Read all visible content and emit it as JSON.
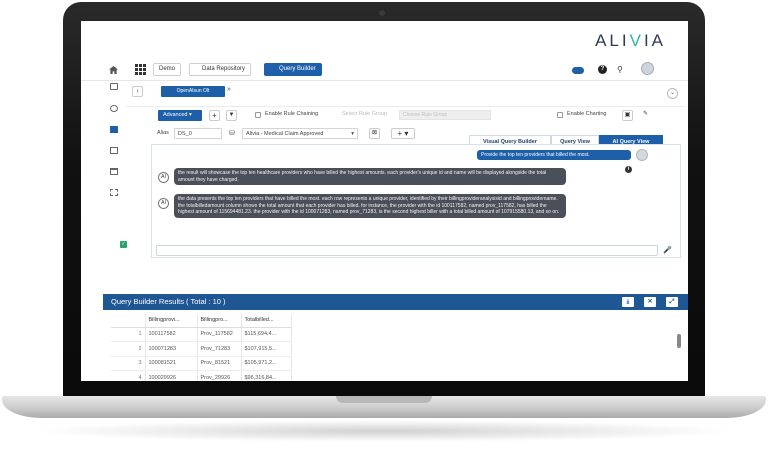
{
  "brand": {
    "logo_text_a": "ALI",
    "logo_text_v": "V",
    "logo_text_b": "IA"
  },
  "topbar": {
    "chips": [
      "Demo",
      "Data Repository",
      "Query Builder"
    ],
    "active_chip": "Query Builder"
  },
  "main": {
    "source_tab": "OpenAIsun Olt",
    "advanced_label": "Advanced",
    "enable_rule_chaining": "Enable Rule Chaining",
    "select_rule_group": "Select Rule Group",
    "choose_rule_group": "Choose Rule Group",
    "enable_charting": "Enable Charting",
    "alias_label": "Alias",
    "alias_value": "DS_0",
    "dataset_value": "Alivia - Medical Claim Approved",
    "view_tabs": [
      "Visual Query Builder",
      "Query View",
      "AI Query View"
    ],
    "active_view_tab": "AI Query View"
  },
  "chat": {
    "user_message": "Provide the top ten providers that billed the most.",
    "bot_label": "AI",
    "bot_message_1": "the result will showcase the top ten healthcare providers who have billed the highest amounts. each provider's unique id and name will be displayed alongside the total amount they have charged.",
    "bot_message_2": "the data presents the top ten providers that have billed the most. each row represents a unique provider, identified by their billingprovideranalysisid and billingprovidername. the totalbilledamount column shows the total amount that each provider has billed. for instance, the provider with the id 100117582, named prov_117582, has billed the highest amount of 115694481.23. the provider with the id 100071283, named prov_71283, is the second highest biller with a total billed amount of 107915580.13, and so on."
  },
  "results": {
    "title": "Query Builder Results ( Total : 10 )",
    "columns": [
      "Billingprovi...",
      "Billingpro...",
      "Totalbilled..."
    ],
    "rows": [
      {
        "n": "1",
        "id": "100117582",
        "name": "Prov_117582",
        "amt": "$115,694,4..."
      },
      {
        "n": "2",
        "id": "100071283",
        "name": "Prov_71283",
        "amt": "$107,915,5..."
      },
      {
        "n": "3",
        "id": "100081521",
        "name": "Prov_81521",
        "amt": "$105,971,2..."
      },
      {
        "n": "4",
        "id": "100029926",
        "name": "Prov_29926",
        "amt": "$96,316,84..."
      }
    ]
  },
  "colors": {
    "accent": "#1d5fa8",
    "results_bar": "#1f5694",
    "brand_teal": "#34b3a0"
  }
}
